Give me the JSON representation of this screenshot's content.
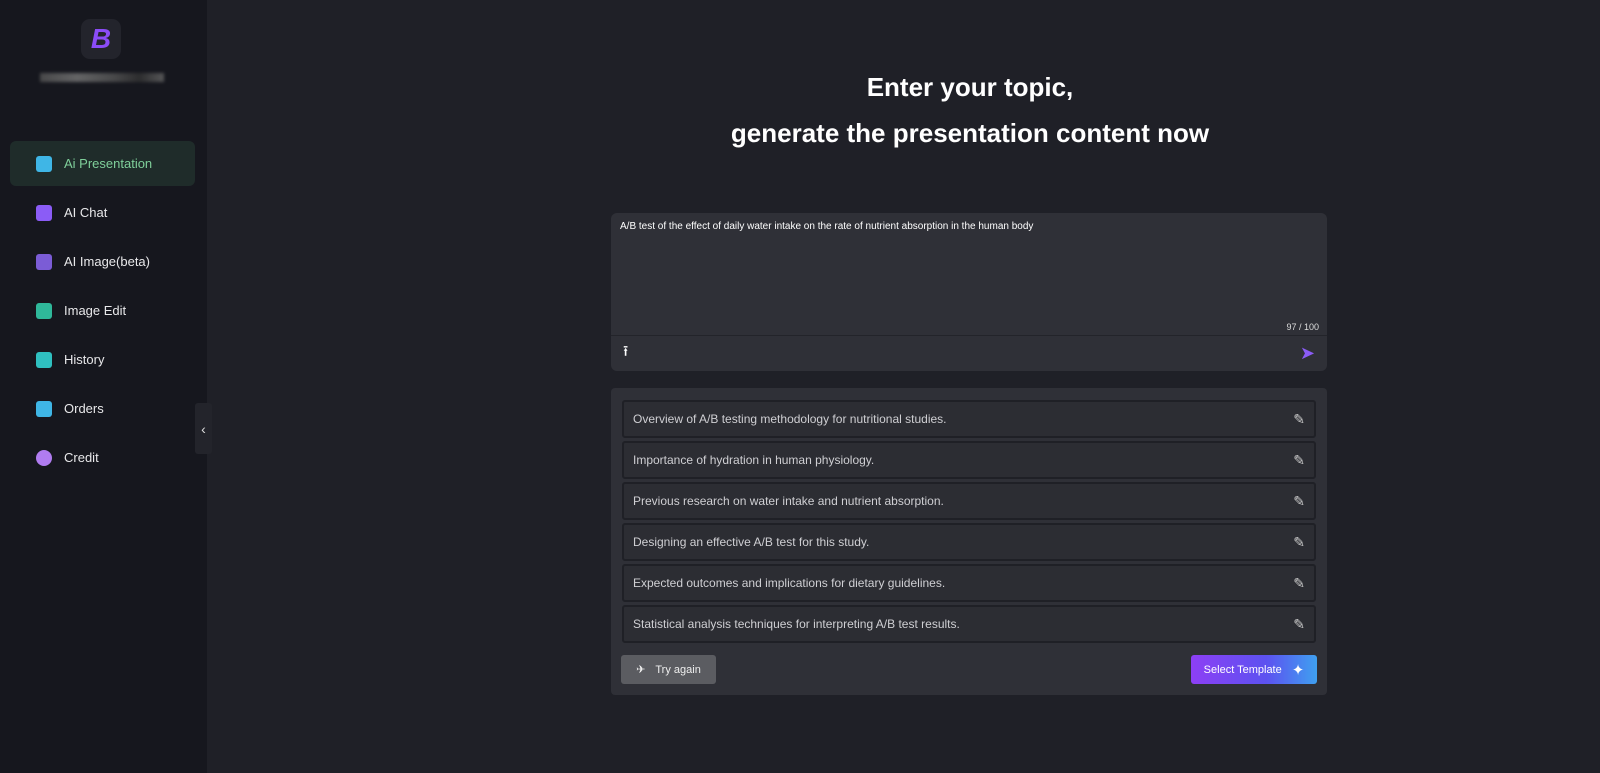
{
  "sidebar": {
    "logo_letter": "B",
    "items": [
      {
        "label": "Ai Presentation",
        "icon": "presentation-icon",
        "color": "#3fb6e6",
        "active": true
      },
      {
        "label": "AI Chat",
        "icon": "ai-chat-icon",
        "color": "#8b5cf6"
      },
      {
        "label": "AI Image(beta)",
        "icon": "ai-image-icon",
        "color": "#8b5cf6"
      },
      {
        "label": "Image Edit",
        "icon": "image-edit-icon",
        "color": "#2fb89a"
      },
      {
        "label": "History",
        "icon": "history-icon",
        "color": "#2fc0c0"
      },
      {
        "label": "Orders",
        "icon": "orders-icon",
        "color": "#3fb6e6"
      },
      {
        "label": "Credit",
        "icon": "credit-icon",
        "color": "#b07cf0"
      }
    ]
  },
  "header": {
    "line1": "Enter your topic,",
    "line2": "generate the presentation content now"
  },
  "input": {
    "value": "A/B test of the effect of daily water intake on the rate of nutrient absorption in the human body",
    "counter": "97 / 100"
  },
  "outline": {
    "items": [
      "Overview of A/B testing methodology for nutritional studies.",
      "Importance of hydration in human physiology.",
      "Previous research on water intake and nutrient absorption.",
      "Designing an effective A/B test for this study.",
      "Expected outcomes and implications for dietary guidelines.",
      "Statistical analysis techniques for interpreting A/B test results."
    ],
    "try_again": "Try again",
    "select_template": "Select Template"
  }
}
